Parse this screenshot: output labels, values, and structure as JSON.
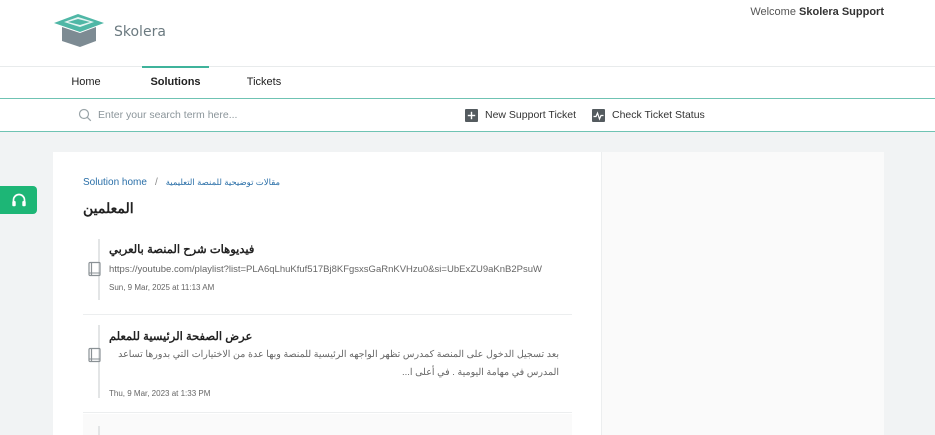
{
  "header": {
    "brand": "Skolera",
    "welcome_prefix": "Welcome",
    "welcome_user": "Skolera Support",
    "colors": {
      "brand_teal": "#4fb7a6",
      "brand_gray": "#7d8b93"
    }
  },
  "nav": {
    "tabs": [
      {
        "label": "Home",
        "active": false
      },
      {
        "label": "Solutions",
        "active": true
      },
      {
        "label": "Tickets",
        "active": false
      }
    ]
  },
  "searchbar": {
    "placeholder": "Enter your search term here...",
    "new_ticket": "New Support Ticket",
    "check_status": "Check Ticket Status"
  },
  "breadcrumb": {
    "home": "Solution home",
    "separator": "/",
    "folder": "مقالات توضيحية للمنصة التعليمية"
  },
  "page": {
    "title": "المعلمين"
  },
  "articles": [
    {
      "title": "فيديوهات شرح المنصة بالعربي",
      "url": "https://youtube.com/playlist?list=PLA6qLhuKfuf517Bj8KFgsxsGaRnKVHzu0&si=UbExZU9aKnB2PsuW",
      "date": "Sun, 9 Mar, 2025 at 11:13 AM"
    },
    {
      "title": "عرض الصفحة الرئيسية للمعلم",
      "desc": "بعد تسجيل الدخول على المنصة كمدرس      تظهر الواجهه الرئيسية للمنصة وبها عدة من الاختيارات التي بدورها تساعد المدرس في مهامة اليومية . في أعلى ا...",
      "date": "Thu, 9 Mar, 2023 at 1:33 PM"
    }
  ],
  "icons": {
    "logo": "skolera-logo-icon",
    "search": "search-icon",
    "new_ticket": "plus-square-icon",
    "check_status": "ticket-status-icon",
    "article": "book-icon",
    "support": "headset-icon"
  },
  "colors": {
    "accent": "#3fb39b",
    "support_green": "#1db676",
    "link": "#2a6fa8"
  }
}
